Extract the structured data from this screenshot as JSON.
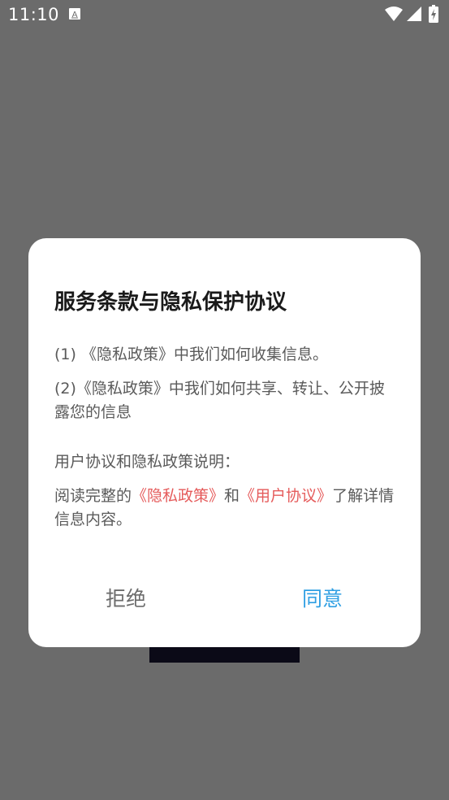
{
  "status_bar": {
    "time": "11:10",
    "notification_icon": "a-letter-icon",
    "icons": [
      "wifi-icon",
      "signal-icon",
      "battery-charging-icon"
    ]
  },
  "dialog": {
    "title": "服务条款与隐私保护协议",
    "item1": "(1) 《隐私政策》中我们如何收集信息。",
    "item2": "(2)《隐私政策》中我们如何共享、转让、公开披露您的信息",
    "section_heading": "用户协议和隐私政策说明：",
    "read_prefix": "阅读完整的",
    "privacy_link": "《隐私政策》",
    "and_text": "和",
    "user_agreement_link": "《用户协议》",
    "read_suffix": "了解详情信息内容。",
    "decline_label": "拒绝",
    "agree_label": "同意"
  },
  "colors": {
    "overlay_background": "#6b6b6b",
    "link": "#e55b5b",
    "agree_button": "#2f9fe3",
    "decline_button": "#6c6c6c"
  }
}
